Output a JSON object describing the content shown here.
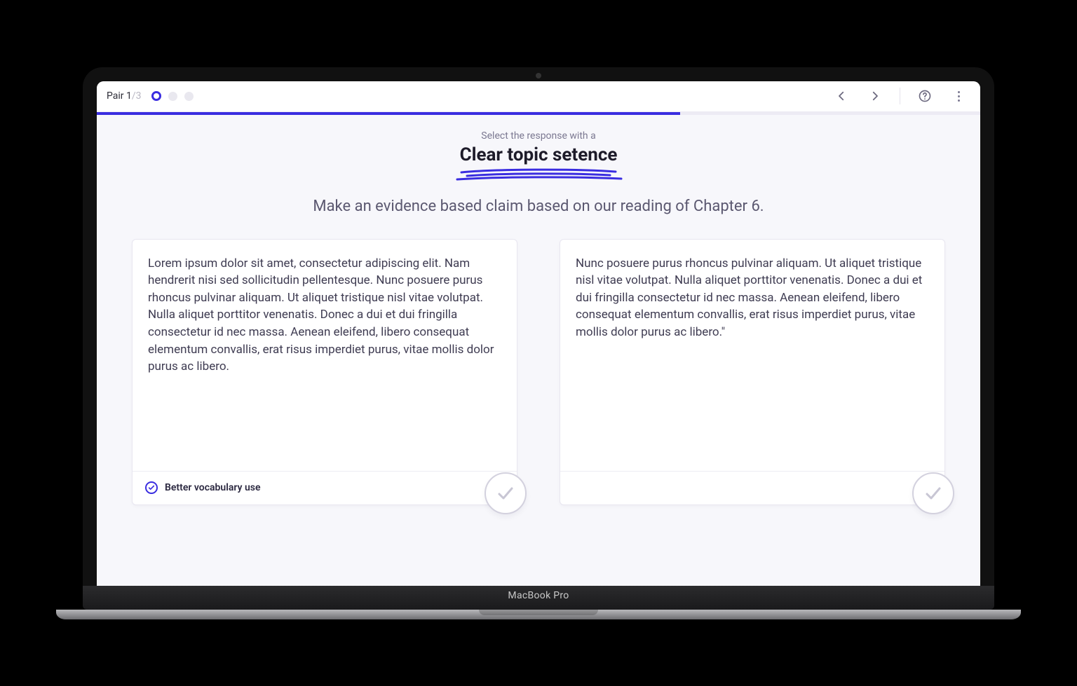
{
  "header": {
    "pair_label_prefix": "Pair ",
    "pair_current": "1",
    "pair_separator": "/",
    "pair_total": "3"
  },
  "progress": {
    "percent": "66%"
  },
  "prompt": {
    "lede_small": "Select the response with a",
    "lede_big": "Clear topic setence",
    "question": "Make an evidence based claim based on our reading of Chapter 6."
  },
  "cards": {
    "left": {
      "body": "Lorem ipsum dolor sit amet, consectetur adipiscing elit. Nam hendrerit nisi sed sollicitudin pellentesque. Nunc posuere purus rhoncus pulvinar aliquam. Ut aliquet tristique nisl vitae volutpat. Nulla aliquet porttitor venenatis. Donec a dui et dui fringilla consectetur id nec massa. Aenean eleifend, libero consequat elementum convallis, erat risus imperdiet purus, vitae mollis dolor purus ac libero.",
      "footer_badge": "Better vocabulary use"
    },
    "right": {
      "body": "Nunc posuere purus rhoncus pulvinar aliquam. Ut aliquet tristique nisl vitae volutpat. Nulla aliquet porttitor venenatis. Donec a dui et dui fringilla consectetur id nec massa. Aenean eleifend, libero consequat elementum convallis, erat risus imperdiet purus, vitae mollis dolor purus ac libero.\""
    }
  },
  "device": {
    "label": "MacBook Pro"
  }
}
